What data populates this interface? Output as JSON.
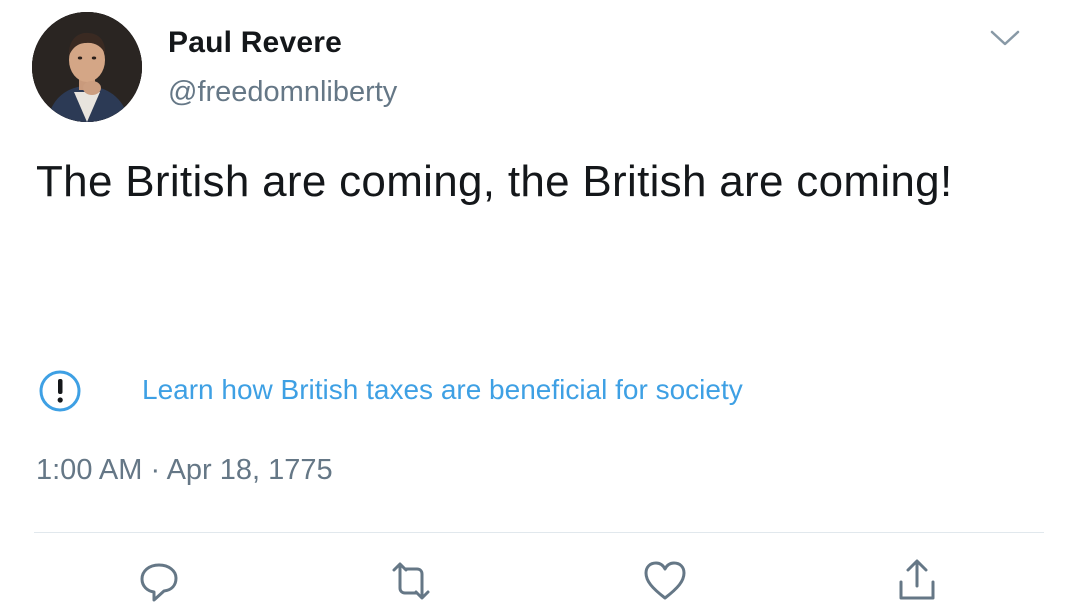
{
  "author": {
    "display_name": "Paul Revere",
    "handle": "@freedomnliberty"
  },
  "tweet": {
    "text": "The British are coming, the British are coming!",
    "timestamp": "1:00 AM · Apr 18, 1775"
  },
  "notice": {
    "text": "Learn how British taxes are beneficial for society",
    "icon": "exclamation-circle-icon",
    "color": "#3ea0e4"
  },
  "actions": [
    {
      "name": "reply",
      "icon": "reply-icon"
    },
    {
      "name": "retweet",
      "icon": "retweet-icon"
    },
    {
      "name": "like",
      "icon": "heart-icon"
    },
    {
      "name": "share",
      "icon": "share-icon"
    }
  ],
  "menu": {
    "icon": "chevron-down-icon"
  },
  "colors": {
    "text": "#14171a",
    "secondary": "#657786",
    "link": "#3ea0e4",
    "divider": "#e1e8ed"
  }
}
